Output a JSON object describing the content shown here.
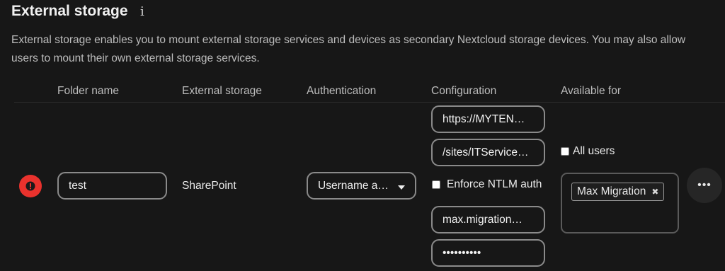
{
  "section": {
    "title": "External storage",
    "info_icon": "info-icon",
    "description": "External storage enables you to mount external storage services and devices as secondary Nextcloud storage devices. You may also allow users to mount their own external storage services."
  },
  "table": {
    "headers": [
      "Folder name",
      "External storage",
      "Authentication",
      "Configuration",
      "Available for"
    ],
    "row": {
      "status_icon": "error-icon",
      "status_color": "#e9322d",
      "folder_name": "test",
      "storage_type": "SharePoint",
      "authentication": "Username a…",
      "config": {
        "host": "https://MYTEN…",
        "share": "/sites/ITServices…",
        "ntlm_label": "Enforce NTLM auth",
        "ntlm_checked": false,
        "user": "max.migration…",
        "password": "••••••••••"
      },
      "available_for": {
        "all_users_label": "All users",
        "all_users_checked": false,
        "tags": [
          "Max Migration"
        ]
      },
      "more_icon": "more-actions-icon",
      "more_label": "•••"
    }
  }
}
